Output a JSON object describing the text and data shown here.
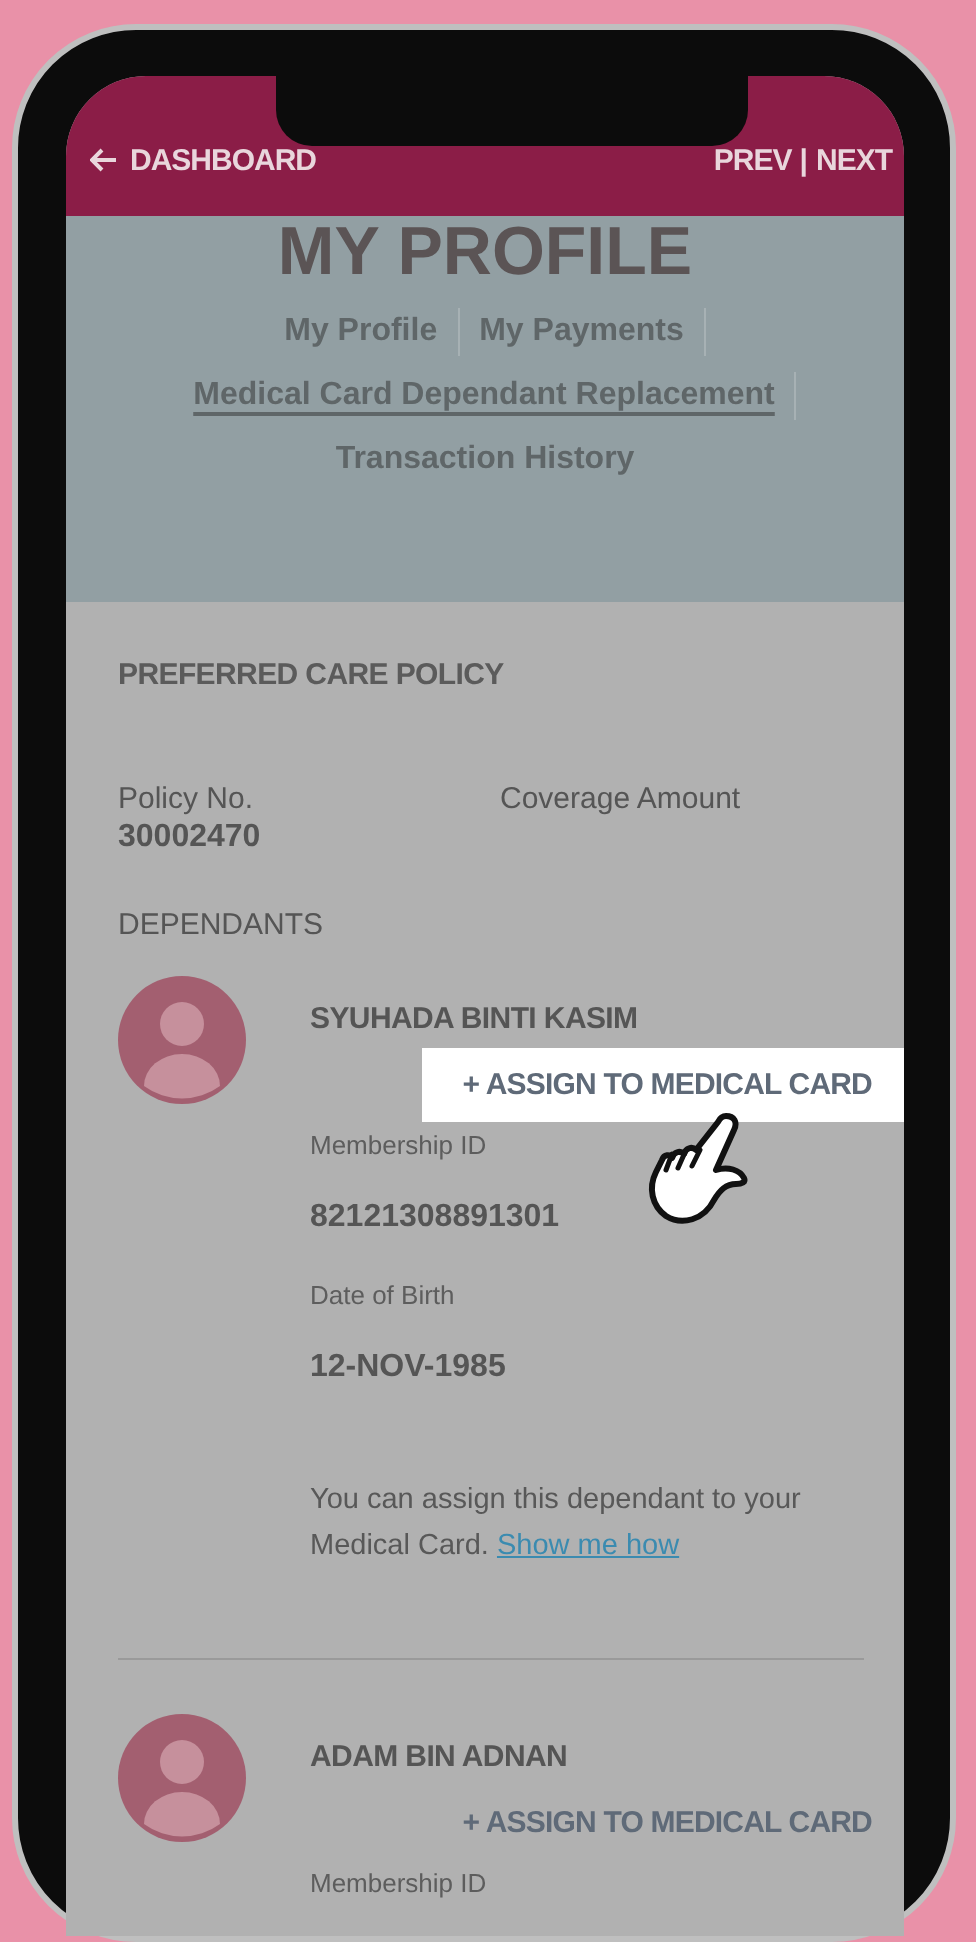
{
  "header": {
    "back_label": "DASHBOARD",
    "prev": "PREV",
    "separator": "|",
    "next": "NEXT"
  },
  "profile": {
    "title": "MY PROFILE",
    "tabs": [
      {
        "label": "My Profile",
        "selected": false
      },
      {
        "label": "My Payments",
        "selected": false
      },
      {
        "label": "Medical Card Dependant Replacement",
        "selected": true
      },
      {
        "label": "Transaction History",
        "selected": false
      }
    ]
  },
  "policy": {
    "title": "PREFERRED CARE POLICY",
    "fields": [
      {
        "label": "Policy No.",
        "value": "30002470"
      },
      {
        "label": "Coverage Amount"
      }
    ]
  },
  "dependants_label": "DEPENDANTS",
  "dependants": [
    {
      "name": "SYUHADA BINTI KASIM",
      "assign_label": "+ ASSIGN TO MEDICAL CARD",
      "highlighted": true,
      "fields": [
        {
          "label": "Membership ID",
          "value": "82121308891301"
        },
        {
          "label": "Date of Birth",
          "value": "12-NOV-1985"
        }
      ],
      "note": {
        "text": "You can assign this dependant to your Medical Card.",
        "link": "Show me how"
      }
    },
    {
      "name": "ADAM BIN ADNAN",
      "assign_label": "+ ASSIGN TO MEDICAL CARD",
      "highlighted": false,
      "fields": [
        {
          "label": "Membership ID"
        }
      ]
    }
  ]
}
